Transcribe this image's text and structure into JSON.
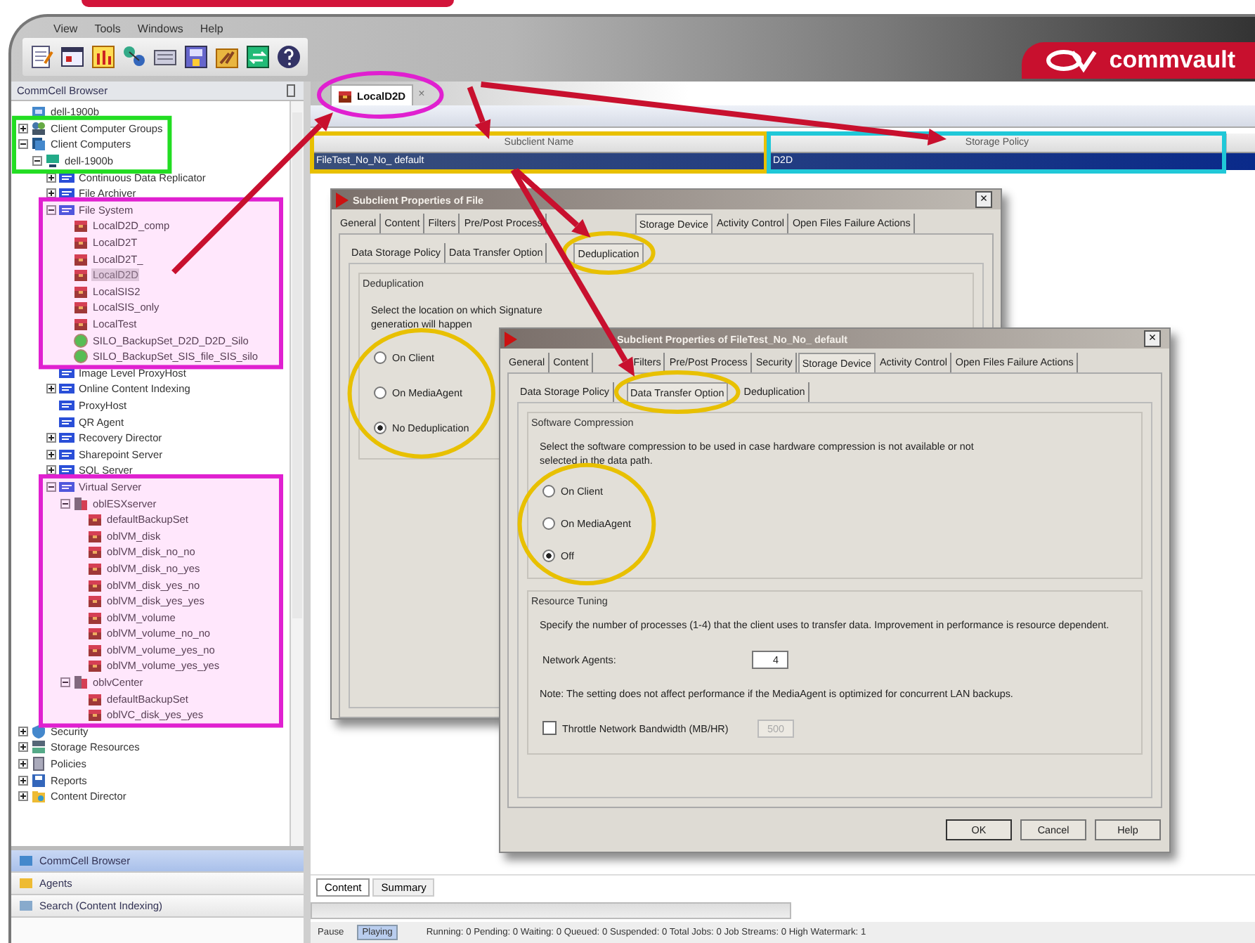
{
  "menu": [
    "View",
    "Tools",
    "Windows",
    "Help"
  ],
  "logo": {
    "text": "commvault"
  },
  "browser": {
    "title": "CommCell Browser",
    "tree": [
      {
        "label": "dell-1900b",
        "kind": "root",
        "children": [
          {
            "label": "Client Computer Groups",
            "kind": "group",
            "expanded": false
          },
          {
            "label": "Client Computers",
            "kind": "computers",
            "expanded": true,
            "children": [
              {
                "label": "dell-1900b",
                "kind": "computer",
                "expanded": true,
                "children": [
                  {
                    "label": "Continuous Data Replicator",
                    "kind": "agent",
                    "expanded": false
                  },
                  {
                    "label": "File Archiver",
                    "kind": "agent",
                    "expanded": false
                  },
                  {
                    "label": "File System",
                    "kind": "agent",
                    "expanded": true,
                    "children": [
                      {
                        "label": "LocalD2D_comp",
                        "kind": "backupset"
                      },
                      {
                        "label": "LocalD2T",
                        "kind": "backupset"
                      },
                      {
                        "label": "LocalD2T_",
                        "kind": "backupset"
                      },
                      {
                        "label": "LocalD2D",
                        "kind": "backupset",
                        "selected": true
                      },
                      {
                        "label": "LocalSIS2",
                        "kind": "backupset"
                      },
                      {
                        "label": "LocalSIS_only",
                        "kind": "backupset"
                      },
                      {
                        "label": "LocalTest",
                        "kind": "backupset"
                      },
                      {
                        "label": "SILO_BackupSet_D2D_D2D_Silo",
                        "kind": "silo"
                      },
                      {
                        "label": "SILO_BackupSet_SIS_file_SIS_silo",
                        "kind": "silo"
                      }
                    ]
                  },
                  {
                    "label": "Image Level ProxyHost",
                    "kind": "agent"
                  },
                  {
                    "label": "Online Content Indexing",
                    "kind": "agent",
                    "expanded": false
                  },
                  {
                    "label": "ProxyHost",
                    "kind": "agent"
                  },
                  {
                    "label": "QR Agent",
                    "kind": "agent"
                  },
                  {
                    "label": "Recovery Director",
                    "kind": "agent",
                    "expanded": false
                  },
                  {
                    "label": "Sharepoint Server",
                    "kind": "agent",
                    "expanded": false
                  },
                  {
                    "label": "SQL Server",
                    "kind": "agent",
                    "expanded": false
                  },
                  {
                    "label": "Virtual Server",
                    "kind": "agent",
                    "expanded": true,
                    "children": [
                      {
                        "label": "oblESXserver",
                        "kind": "server",
                        "expanded": true,
                        "children": [
                          {
                            "label": "defaultBackupSet",
                            "kind": "backupset"
                          },
                          {
                            "label": "oblVM_disk",
                            "kind": "backupset"
                          },
                          {
                            "label": "oblVM_disk_no_no",
                            "kind": "backupset"
                          },
                          {
                            "label": "oblVM_disk_no_yes",
                            "kind": "backupset"
                          },
                          {
                            "label": "oblVM_disk_yes_no",
                            "kind": "backupset"
                          },
                          {
                            "label": "oblVM_disk_yes_yes",
                            "kind": "backupset"
                          },
                          {
                            "label": "oblVM_volume",
                            "kind": "backupset"
                          },
                          {
                            "label": "oblVM_volume_no_no",
                            "kind": "backupset"
                          },
                          {
                            "label": "oblVM_volume_yes_no",
                            "kind": "backupset"
                          },
                          {
                            "label": "oblVM_volume_yes_yes",
                            "kind": "backupset"
                          }
                        ]
                      },
                      {
                        "label": "oblvCenter",
                        "kind": "server",
                        "expanded": true,
                        "children": [
                          {
                            "label": "defaultBackupSet",
                            "kind": "backupset"
                          },
                          {
                            "label": "oblVC_disk_yes_yes",
                            "kind": "backupset"
                          }
                        ]
                      }
                    ]
                  }
                ]
              }
            ]
          },
          {
            "label": "Security",
            "kind": "security",
            "expanded": false
          },
          {
            "label": "Storage Resources",
            "kind": "storage",
            "expanded": false
          },
          {
            "label": "Policies",
            "kind": "policies",
            "expanded": false
          },
          {
            "label": "Reports",
            "kind": "reports",
            "expanded": false
          },
          {
            "label": "Content Director",
            "kind": "director",
            "expanded": false
          }
        ]
      }
    ],
    "nav": [
      {
        "label": "CommCell Browser",
        "selected": true
      },
      {
        "label": "Agents",
        "selected": false
      },
      {
        "label": "Search (Content Indexing)",
        "selected": false
      }
    ]
  },
  "tabs": [
    {
      "label": "LocalD2D",
      "selected": true,
      "close": "×"
    }
  ],
  "table": {
    "columns": [
      "Subclient Name",
      "Storage Policy"
    ],
    "rows": [
      {
        "cells": [
          "FileTest_No_No_ default",
          "D2D"
        ],
        "selected": true
      }
    ]
  },
  "dialogs": [
    {
      "title": "Subclient Properties of File",
      "close": "×",
      "tabs": [
        {
          "label": "General",
          "selected": false
        },
        {
          "label": "Content",
          "selected": false
        },
        {
          "label": "Filters",
          "selected": false
        },
        {
          "label": "Pre/Post Process",
          "selected": false
        },
        {
          "label": "Storage Device",
          "selected": true
        },
        {
          "label": "Activity Control",
          "selected": false
        },
        {
          "label": "Open Files Failure Actions",
          "selected": false
        }
      ],
      "subtabs": [
        {
          "label": "Data Storage Policy",
          "selected": false
        },
        {
          "label": "Data Transfer Option",
          "selected": false
        },
        {
          "label": "Deduplication",
          "selected": true
        }
      ],
      "groups": [
        {
          "title": "Deduplication",
          "items": [
            {
              "kind": "text",
              "text": "Select the location on which Signature generation will happen"
            },
            {
              "kind": "radio",
              "label": "On Client",
              "selected": false
            },
            {
              "kind": "radio",
              "label": "On MediaAgent",
              "selected": false
            },
            {
              "kind": "radio",
              "label": "No Deduplication",
              "selected": true
            }
          ]
        }
      ]
    },
    {
      "title": "Subclient Properties of FileTest_No_No_ default",
      "close": "×",
      "tabs": [
        {
          "label": "General",
          "selected": false
        },
        {
          "label": "Content",
          "selected": false
        },
        {
          "label": "Filters",
          "selected": false
        },
        {
          "label": "Pre/Post Process",
          "selected": false
        },
        {
          "label": "Security",
          "selected": false
        },
        {
          "label": "Storage Device",
          "selected": true
        },
        {
          "label": "Activity Control",
          "selected": false
        },
        {
          "label": "Open Files Failure Actions",
          "selected": false
        }
      ],
      "subtabs": [
        {
          "label": "Data Storage Policy",
          "selected": false
        },
        {
          "label": "Data Transfer Option",
          "selected": true
        },
        {
          "label": "Deduplication",
          "selected": false
        }
      ],
      "groups": [
        {
          "title": "Software Compression",
          "items": [
            {
              "kind": "text",
              "text": "Select the software compression to be used in case hardware compression is not available or not selected in the data path."
            },
            {
              "kind": "radio",
              "label": "On Client",
              "selected": false
            },
            {
              "kind": "radio",
              "label": "On MediaAgent",
              "selected": false
            },
            {
              "kind": "radio",
              "label": "Off",
              "selected": true
            }
          ]
        },
        {
          "title": "Resource Tuning",
          "items": [
            {
              "kind": "text",
              "text": "Specify the number of processes (1-4) that the client uses to transfer data. Improvement in performance is resource dependent."
            },
            {
              "kind": "spinner",
              "label": "Network Agents:",
              "value": "4",
              "disabled": false
            },
            {
              "kind": "text",
              "text": "Note: The setting does not affect performance if the MediaAgent is optimized for concurrent LAN backups."
            },
            {
              "kind": "checkbox",
              "label": "Throttle Network Bandwidth (MB/HR)",
              "checked": false,
              "value": "500",
              "disabled": true
            }
          ]
        }
      ],
      "buttons": [
        "OK",
        "Cancel",
        "Help"
      ]
    }
  ],
  "bottom_tabs": [
    {
      "label": "Content",
      "selected": true
    },
    {
      "label": "Summary",
      "selected": false
    }
  ],
  "status_bar": {
    "pause": "Pause",
    "playing": "Playing",
    "stats": "Running: 0 Pending: 0 Waiting: 0 Queued: 0 Suspended: 0 Total Jobs: 0 Job Streams: 0 High Watermark: 1"
  }
}
